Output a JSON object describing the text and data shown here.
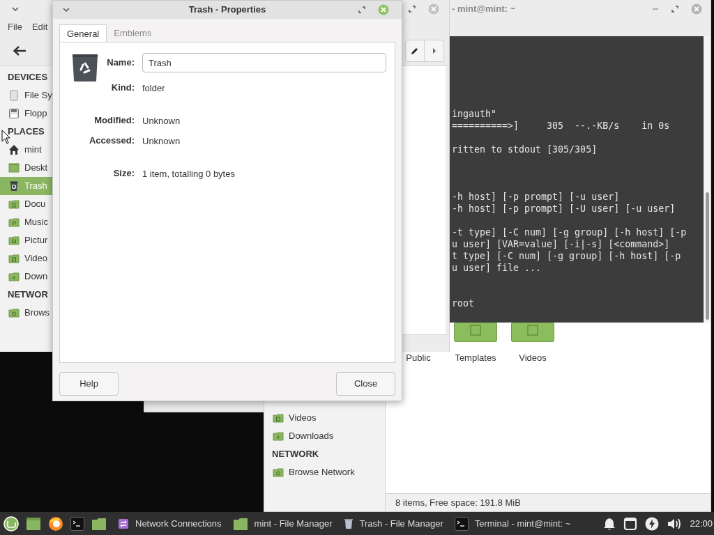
{
  "trash_file_manager": {
    "menu": [
      "File",
      "Edit"
    ],
    "sidebar": [
      {
        "heading": "DEVICES",
        "items": [
          {
            "label": "File Sy",
            "kind": "drive",
            "selected": false
          },
          {
            "label": "Flopp",
            "kind": "floppy",
            "selected": false
          }
        ]
      },
      {
        "heading": "PLACES",
        "items": [
          {
            "label": "mint",
            "kind": "home",
            "selected": false
          },
          {
            "label": "Deskt",
            "kind": "desktop",
            "selected": false
          },
          {
            "label": "Trash",
            "kind": "trash",
            "selected": true
          },
          {
            "label": "Docu",
            "kind": "documents",
            "selected": false
          },
          {
            "label": "Music",
            "kind": "music",
            "selected": false
          },
          {
            "label": "Pictur",
            "kind": "pictures",
            "selected": false
          },
          {
            "label": "Video",
            "kind": "videos",
            "selected": false
          },
          {
            "label": "Down",
            "kind": "downloads",
            "selected": false
          }
        ]
      },
      {
        "heading": "NETWOR",
        "items": [
          {
            "label": "Brows",
            "kind": "network",
            "selected": false
          }
        ]
      }
    ]
  },
  "terminal": {
    "title": "- mint@mint: ~",
    "lines": [
      "ingauth\"",
      "==========>]     305  --.-KB/s    in 0s",
      "ritten to stdout [305/305]",
      "-h host] [-p prompt] [-u user]",
      "-h host] [-p prompt] [-U user] [-u user]",
      "-t type] [-C num] [-g group] [-h host] [-p",
      "u user] [VAR=value] [-i|-s] [<command>]",
      "t type] [-C num] [-g group] [-h host] [-p",
      "u user] file ...",
      "root"
    ]
  },
  "mint_file_manager": {
    "sidebar": [
      {
        "items": [
          {
            "label": "Videos",
            "kind": "videos",
            "selected": false
          },
          {
            "label": "Downloads",
            "kind": "downloads",
            "selected": false
          }
        ]
      },
      {
        "heading": "NETWORK",
        "items": [
          {
            "label": "Browse Network",
            "kind": "network",
            "selected": false
          }
        ]
      }
    ],
    "icons": [
      {
        "label": "Public"
      },
      {
        "label": "Templates",
        "kind": "folder"
      },
      {
        "label": "Videos",
        "kind": "folder"
      }
    ],
    "status": "8 items, Free space: 191.8 MiB"
  },
  "properties": {
    "title": "Trash - Properties",
    "tabs": [
      {
        "label": "General",
        "selected": true
      },
      {
        "label": "Emblems",
        "selected": false
      }
    ],
    "fields": [
      {
        "label": "Name:",
        "value": "Trash",
        "kind": "input"
      },
      {
        "label": "Kind:",
        "value": "folder",
        "kind": "text"
      },
      {
        "label": "Modified:",
        "value": "Unknown",
        "kind": "text"
      },
      {
        "label": "Accessed:",
        "value": "Unknown",
        "kind": "text"
      },
      {
        "label": "Size:",
        "value": "1 item, totalling 0 bytes",
        "kind": "text"
      }
    ],
    "buttons": [
      "Help",
      "Close"
    ]
  },
  "taskbar": {
    "launchers": [
      {
        "kind": "menu"
      },
      {
        "kind": "files"
      },
      {
        "kind": "browser"
      },
      {
        "kind": "terminal"
      },
      {
        "kind": "folder"
      }
    ],
    "windows": [
      {
        "label": "Network Connections",
        "kind": "network"
      },
      {
        "label": "mint - File Manager",
        "kind": "folder"
      },
      {
        "label": "Trash - File Manager",
        "kind": "trash"
      },
      {
        "label": "Terminal - mint@mint: ~",
        "kind": "terminal"
      }
    ],
    "tray": [
      {
        "kind": "bell"
      },
      {
        "kind": "window"
      },
      {
        "kind": "power"
      },
      {
        "kind": "volume"
      }
    ],
    "clock": "22:00"
  }
}
